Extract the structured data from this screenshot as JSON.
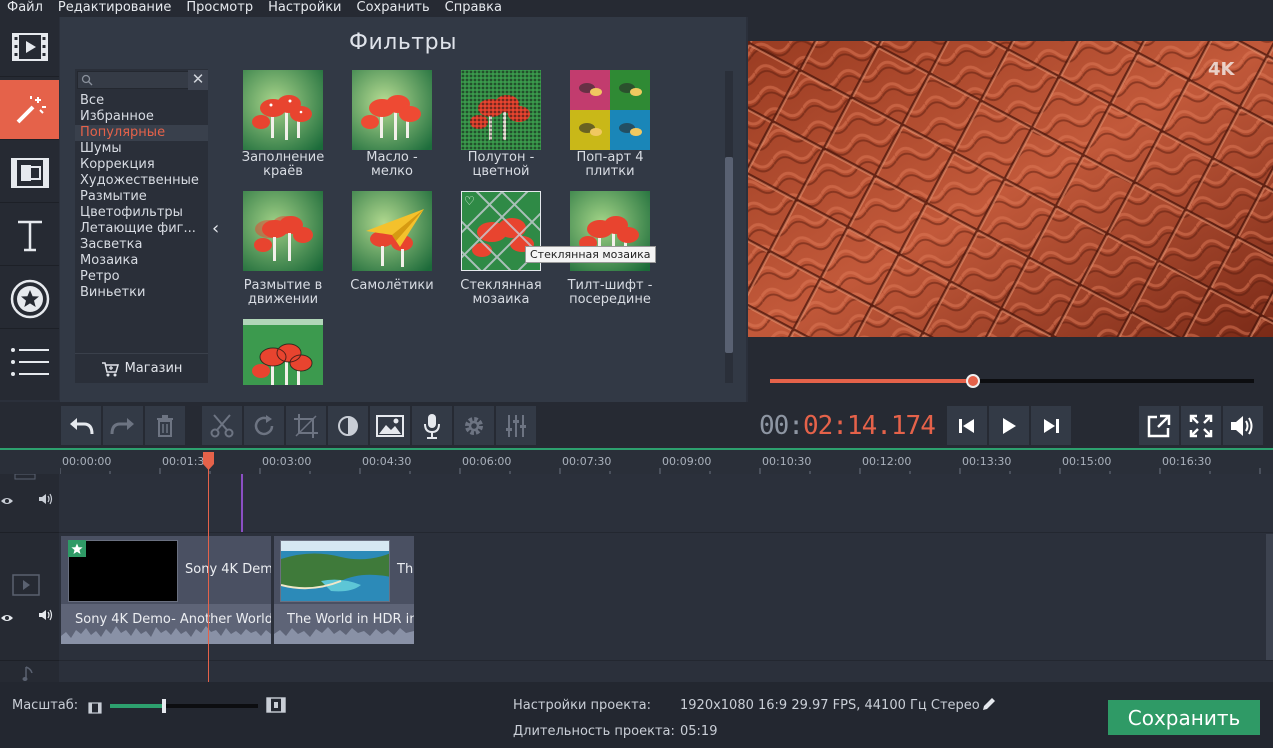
{
  "menu": [
    "Файл",
    "Редактирование",
    "Просмотр",
    "Настройки",
    "Сохранить",
    "Справка"
  ],
  "sidebar_icons": [
    "film-icon",
    "magic-wand-icon",
    "transition-icon",
    "text-icon",
    "star-sticker-icon",
    "list-icon"
  ],
  "filters": {
    "title": "Фильтры",
    "search_placeholder": "",
    "categories": [
      "Все",
      "Избранное",
      "Популярные",
      "Шумы",
      "Коррекция",
      "Художественные",
      "Размытие",
      "Цветофильтры",
      "Летающие фиг...",
      "Засветка",
      "Мозаика",
      "Ретро",
      "Виньетки"
    ],
    "selected_category": "Популярные",
    "shop_label": "Магазин",
    "items": [
      {
        "l1": "Заполнение",
        "l2": "краёв"
      },
      {
        "l1": "Масло -",
        "l2": "мелко"
      },
      {
        "l1": "Полутон -",
        "l2": "цветной"
      },
      {
        "l1": "Поп-арт 4",
        "l2": "плитки"
      },
      {
        "l1": "Размытие в",
        "l2": "движении"
      },
      {
        "l1": "Самолётики",
        "l2": ""
      },
      {
        "l1": "Стеклянная",
        "l2": "мозаика"
      },
      {
        "l1": "Тилт-шифт -",
        "l2": "посередине"
      },
      {
        "l1": "",
        "l2": ""
      }
    ],
    "tooltip": "Стеклянная мозаика"
  },
  "preview": {
    "badge": "4K",
    "progress": 0.42,
    "timecode_dim": "00:",
    "timecode": "02:14.174"
  },
  "timeline": {
    "ticks": [
      "00:00:00",
      "00:01:30",
      "00:03:00",
      "00:04:30",
      "00:06:00",
      "00:07:30",
      "00:09:00",
      "00:10:30",
      "00:12:00",
      "00:13:30",
      "00:15:00",
      "00:16:30"
    ],
    "clips": [
      {
        "video_title": "Sony 4K Dem",
        "audio_title": "Sony 4K Demo- Another World."
      },
      {
        "video_title": "Th",
        "audio_title": "The World in HDR in"
      }
    ]
  },
  "footer": {
    "scale_label": "Масштаб:",
    "scale_value": 0.38,
    "settings_label": "Настройки проекта:",
    "settings_value": "1920x1080 16:9 29.97 FPS, 44100 Гц Стерео",
    "duration_label": "Длительность проекта:",
    "duration_value": "05:19",
    "save_label": "Сохранить"
  },
  "colors": {
    "accent": "#e5624a",
    "green": "#2f9a66",
    "panel": "#323945"
  }
}
